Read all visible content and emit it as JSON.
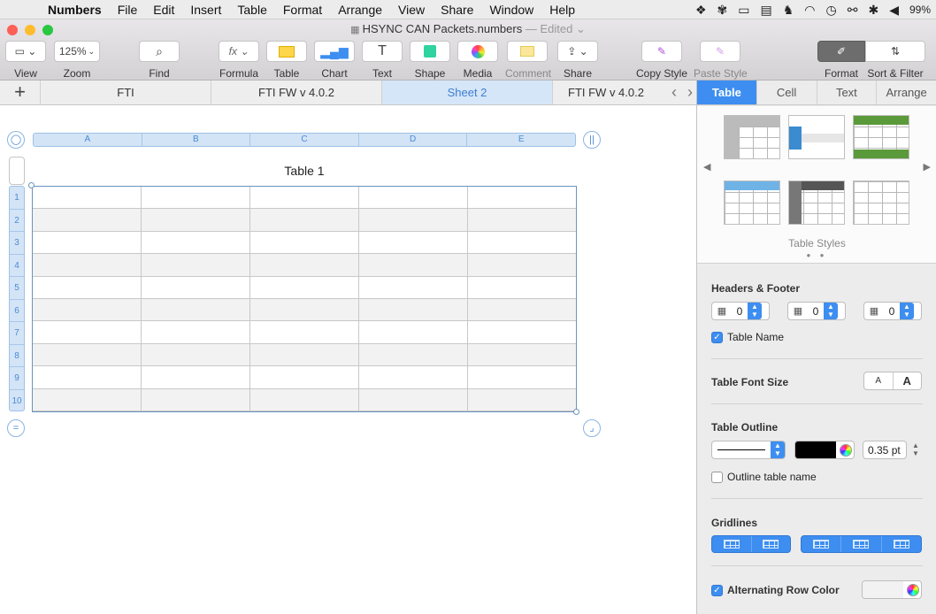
{
  "menubar": {
    "apple": "",
    "items": [
      "Numbers",
      "File",
      "Edit",
      "Insert",
      "Table",
      "Format",
      "Arrange",
      "View",
      "Share",
      "Window",
      "Help"
    ],
    "battery": "99%"
  },
  "window": {
    "title": "HSYNC CAN Packets.numbers",
    "edited": "— Edited ⌄"
  },
  "toolbar": {
    "view": "View",
    "zoom_value": "125%",
    "zoom": "Zoom",
    "find": "Find",
    "formula": "Formula",
    "table": "Table",
    "chart": "Chart",
    "text": "Text",
    "shape": "Shape",
    "media": "Media",
    "comment": "Comment",
    "share": "Share",
    "copy_style": "Copy Style",
    "paste_style": "Paste Style",
    "format": "Format",
    "sort_filter": "Sort & Filter"
  },
  "sheet_tabs": {
    "add": "+",
    "tabs": [
      "FTI",
      "FTI FW v 4.0.2",
      "Sheet 2",
      "FTI FW v 4.0.2"
    ],
    "active_index": 2
  },
  "table": {
    "title": "Table 1",
    "columns": [
      "A",
      "B",
      "C",
      "D",
      "E"
    ],
    "rows": [
      "1",
      "2",
      "3",
      "4",
      "5",
      "6",
      "7",
      "8",
      "9",
      "10"
    ]
  },
  "inspector": {
    "tabs": [
      "Table",
      "Cell",
      "Text",
      "Arrange"
    ],
    "active_tab": "Table",
    "table_styles_label": "Table Styles",
    "headers_footer": {
      "heading": "Headers & Footer",
      "header_rows": "0",
      "header_cols": "0",
      "footer_rows": "0"
    },
    "table_name_label": "Table Name",
    "table_name_checked": true,
    "font_size": {
      "heading": "Table Font Size",
      "smaller": "A",
      "larger": "A"
    },
    "outline": {
      "heading": "Table Outline",
      "color": "#000000",
      "width": "0.35 pt",
      "outline_name_label": "Outline table name",
      "outline_name_checked": false
    },
    "gridlines_heading": "Gridlines",
    "alternating_label": "Alternating Row Color",
    "alternating_checked": true
  },
  "colors": {
    "accent": "#3d8ef0",
    "header_fill": "#d3e4f6",
    "close": "#fc5f57",
    "minimize": "#fdbc2e",
    "zoom": "#28c840"
  }
}
